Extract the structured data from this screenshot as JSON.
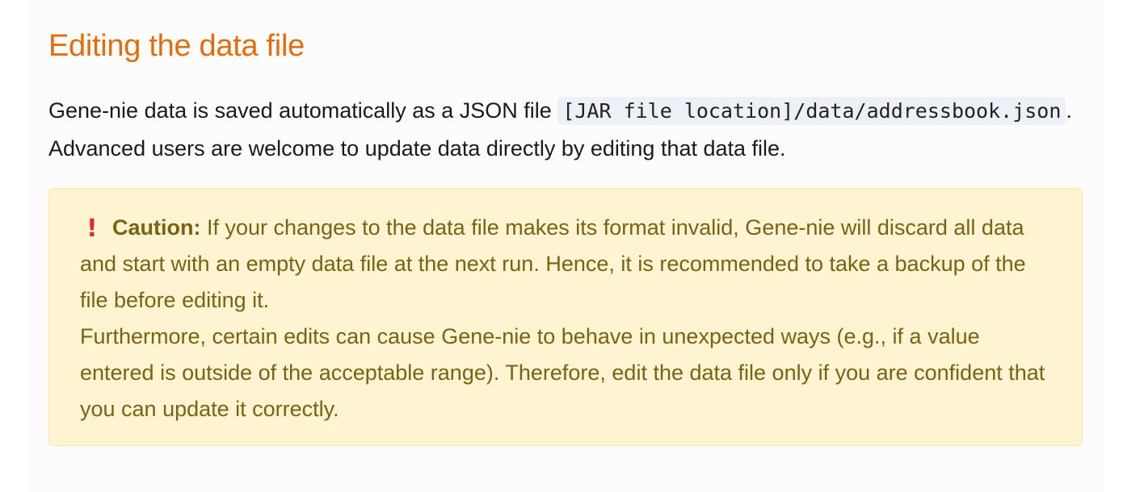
{
  "section": {
    "title": "Editing the data file"
  },
  "paragraph": {
    "text_before": "Gene-nie data is saved automatically as a JSON file ",
    "code": "[JAR file location]/data/addressbook.json",
    "text_after": ". Advanced users are welcome to update data directly by editing that data file."
  },
  "caution": {
    "icon": "exclamation-icon",
    "label": "Caution:",
    "line1": " If your changes to the data file makes its format invalid, Gene-nie will discard all data and start with an empty data file at the next run. Hence, it is recommended to take a backup of the file before editing it.",
    "line2": "Furthermore, certain edits can cause Gene-nie to behave in unexpected ways (e.g., if a value entered is outside of the acceptable range). Therefore, edit the data file only if you are confident that you can update it correctly.",
    "colors": {
      "background": "#fff4d2",
      "text": "#7a6213",
      "icon": "#e02b2b"
    }
  },
  "colors": {
    "heading": "#e46c0a"
  }
}
